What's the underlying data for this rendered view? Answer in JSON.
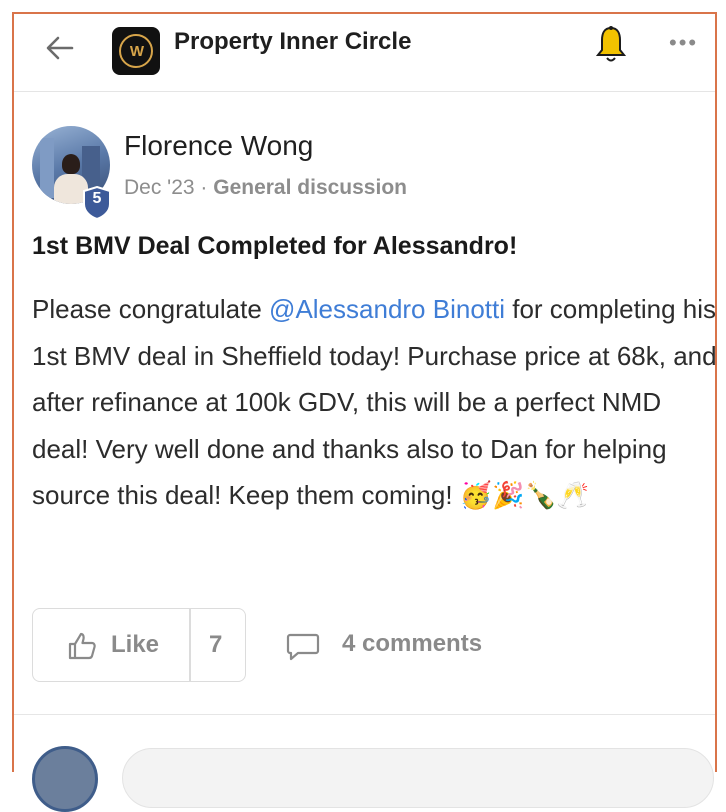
{
  "header": {
    "group_name": "Property Inner Circle",
    "logo_text": "W",
    "icons": {
      "back": "back-arrow-icon",
      "bell": "bell-icon",
      "more": "more-icon"
    }
  },
  "post": {
    "author": "Florence Wong",
    "level": "5",
    "date": "Dec '23",
    "separator": "·",
    "category": "General discussion",
    "title": "1st BMV Deal Completed for Alessandro!",
    "body_prefix": "Please congratulate ",
    "mention": "@Alessandro Binotti",
    "body_suffix": " for completing his 1st BMV deal in Sheffield today! Purchase price at 68k, and after refinance at 100k GDV, this will be a perfect NMD deal! Very well done and thanks also to Dan for helping source this deal! Keep them coming! ",
    "emojis": "🥳🎉🍾🥂"
  },
  "actions": {
    "like_label": "Like",
    "like_count": "7",
    "comments_label": "4 comments"
  },
  "colors": {
    "accent_border": "#d9744a",
    "mention": "#3f7dd6",
    "badge": "#3d5a99",
    "bell": "#f2c200"
  }
}
